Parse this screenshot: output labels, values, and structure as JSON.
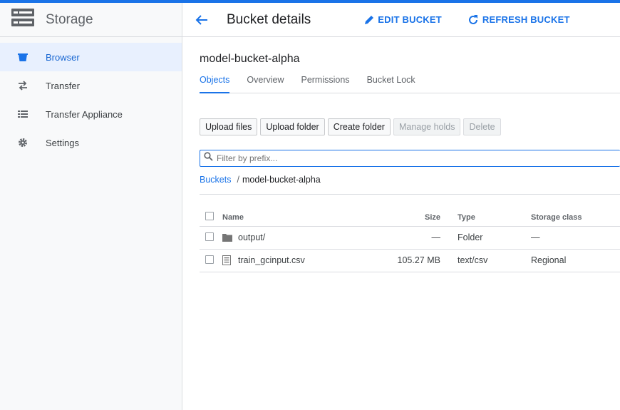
{
  "sidebar": {
    "title": "Storage",
    "items": [
      {
        "label": "Browser",
        "icon": "bucket-icon",
        "active": true
      },
      {
        "label": "Transfer",
        "icon": "transfer-arrows-icon"
      },
      {
        "label": "Transfer Appliance",
        "icon": "list-icon"
      },
      {
        "label": "Settings",
        "icon": "gear-icon"
      }
    ]
  },
  "header": {
    "title": "Bucket details",
    "edit_label": "EDIT BUCKET",
    "refresh_label": "REFRESH BUCKET"
  },
  "bucket": {
    "name": "model-bucket-alpha",
    "tabs": [
      "Objects",
      "Overview",
      "Permissions",
      "Bucket Lock"
    ]
  },
  "actions": {
    "upload_files": "Upload files",
    "upload_folder": "Upload folder",
    "create_folder": "Create folder",
    "manage_holds": "Manage holds",
    "delete": "Delete"
  },
  "filter": {
    "placeholder": "Filter by prefix..."
  },
  "breadcrumb": {
    "root": "Buckets",
    "sep": "/",
    "current": "model-bucket-alpha"
  },
  "table": {
    "columns": {
      "name": "Name",
      "size": "Size",
      "type": "Type",
      "storage_class": "Storage class"
    },
    "rows": [
      {
        "name": "output/",
        "size": "—",
        "type": "Folder",
        "storage_class": "—",
        "icon": "folder-icon"
      },
      {
        "name": "train_gcinput.csv",
        "size": "105.27 MB",
        "type": "text/csv",
        "storage_class": "Regional",
        "icon": "file-icon"
      }
    ]
  },
  "colors": {
    "accent": "#1a73e8",
    "active_bg": "#e8f0fe"
  }
}
